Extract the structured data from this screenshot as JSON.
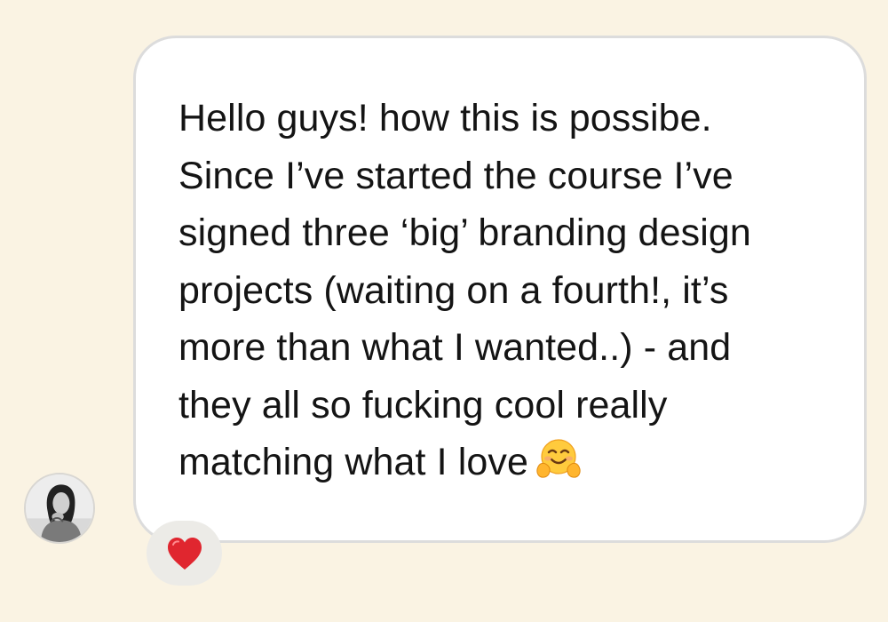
{
  "message": {
    "text": "Hello guys! how this is possibe.\nSince I’ve started the course I’ve\nsigned three ‘big’ branding design\nprojects (waiting on a fourth!, it’s\nmore than what I wanted..) - and\nthey all so fucking cool really\nmatching what I love",
    "trailing_emoji": "hugging-face-emoji"
  },
  "sender": {
    "avatar": "profile-photo"
  },
  "reaction": {
    "icon": "red-heart-icon",
    "color": "#e0262f"
  },
  "colors": {
    "background": "#faf3e3",
    "bubble": "#ffffff",
    "bubble_border": "#dcdcdc",
    "reaction_pill": "#ecebe7",
    "text": "#141414"
  }
}
